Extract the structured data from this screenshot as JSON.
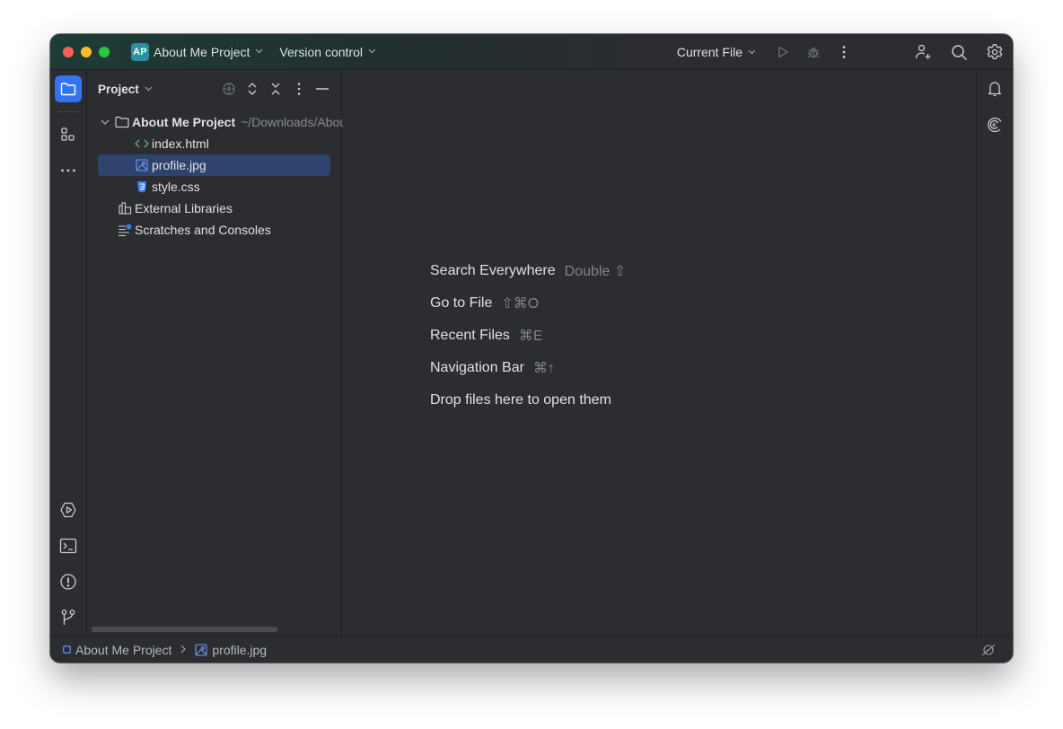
{
  "titlebar": {
    "project_badge": "AP",
    "project_name": "About Me Project",
    "vcs_label": "Version control",
    "run_config": "Current File",
    "icons": [
      "play-icon",
      "debug-icon",
      "more-vertical-icon",
      "add-user-icon",
      "search-icon",
      "gear-icon"
    ]
  },
  "left_strip": {
    "top": [
      "folder-icon",
      "structure-icon",
      "more-horizontal-icon"
    ],
    "bottom": [
      "run-icon",
      "terminal-icon",
      "problems-icon",
      "git-branch-icon"
    ]
  },
  "project_panel": {
    "title": "Project",
    "actions": [
      "locate-icon",
      "expand-all-icon",
      "collapse-all-icon",
      "options-icon",
      "hide-icon"
    ],
    "tree": [
      {
        "label": "About Me Project",
        "hint": "~/Downloads/Abou",
        "type": "folder",
        "expanded": true,
        "level": 0
      },
      {
        "label": "index.html",
        "type": "html-file",
        "level": 1
      },
      {
        "label": "profile.jpg",
        "type": "image-file",
        "level": 1,
        "selected": true
      },
      {
        "label": "style.css",
        "type": "css-file",
        "level": 1
      },
      {
        "label": "External Libraries",
        "type": "library",
        "level": 0
      },
      {
        "label": "Scratches and Consoles",
        "type": "scratches",
        "level": 0
      }
    ]
  },
  "editor": {
    "hints": [
      {
        "label": "Search Everywhere",
        "shortcut": "Double ⇧"
      },
      {
        "label": "Go to File",
        "shortcut": "⇧⌘O"
      },
      {
        "label": "Recent Files",
        "shortcut": "⌘E"
      },
      {
        "label": "Navigation Bar",
        "shortcut": "⌘↑"
      },
      {
        "label": "Drop files here to open them",
        "shortcut": ""
      }
    ]
  },
  "right_strip": [
    "notifications-icon",
    "ai-assistant-icon"
  ],
  "statusbar": {
    "breadcrumbs": [
      "About Me Project",
      "profile.jpg"
    ],
    "right_icon": "power-save-icon"
  },
  "colors": {
    "accent": "#3574f0",
    "selection": "#2e436e",
    "badge": "#2a8f9e",
    "background": "#2b2d30"
  }
}
